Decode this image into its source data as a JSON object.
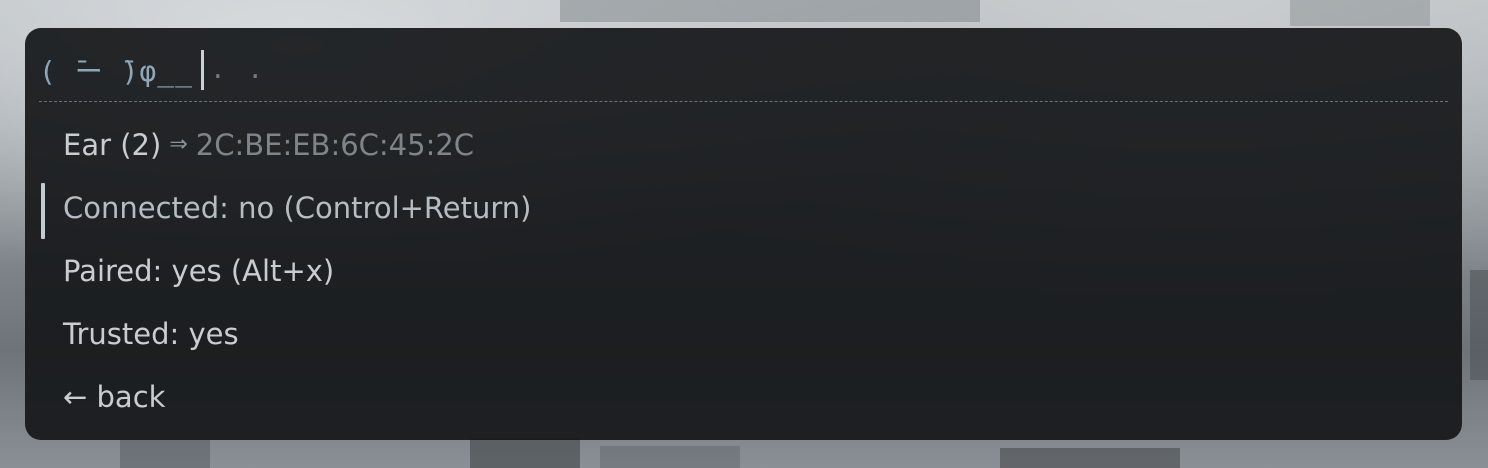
{
  "prompt": {
    "symbol": "( ̄ー ̄)φ__",
    "input_value": ". ."
  },
  "device_menu": {
    "header": {
      "name": "Ear (2)",
      "arrow": "⇒",
      "mac": "2C:BE:EB:6C:45:2C"
    },
    "items": [
      {
        "label": "Connected: no (Control+Return)",
        "selected": true
      },
      {
        "label": "Paired: yes (Alt+x)",
        "selected": false
      },
      {
        "label": "Trusted: yes",
        "selected": false
      },
      {
        "label": "← back",
        "selected": false
      }
    ]
  },
  "colors": {
    "window_bg": "#16181a",
    "prompt": "#8fa6b8",
    "text": "#c9cdd1",
    "muted": "#7d858b",
    "selection_bar": "#c3cbd3"
  }
}
